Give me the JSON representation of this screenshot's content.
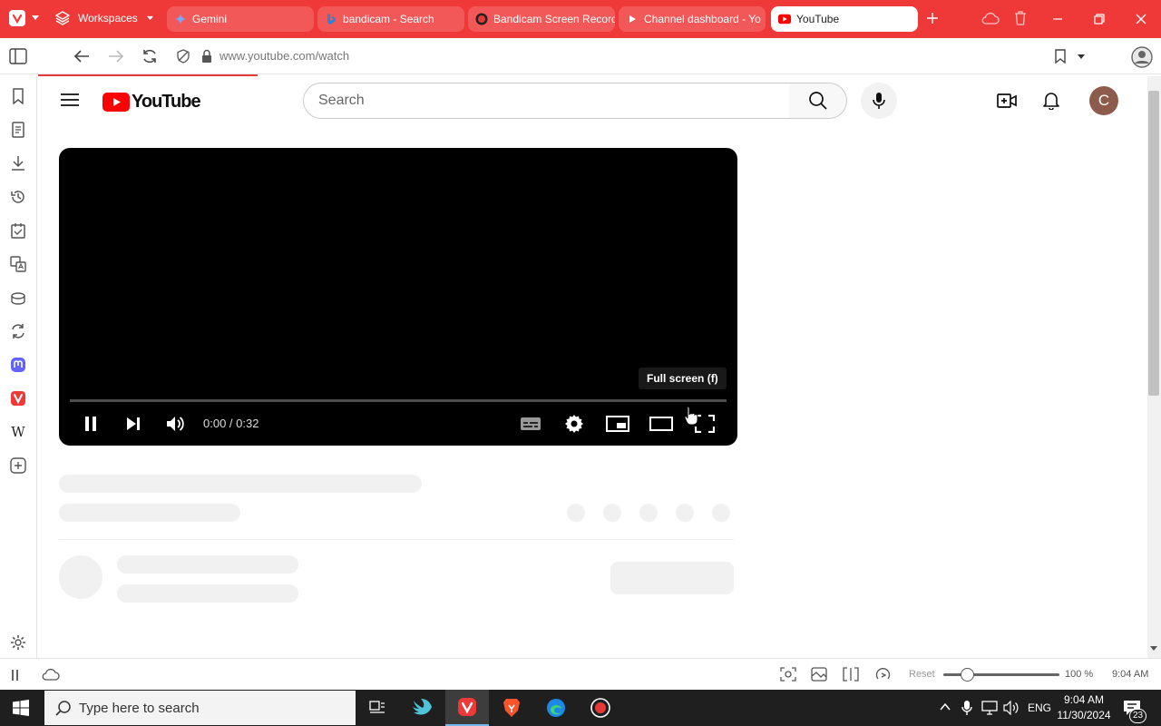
{
  "browser": {
    "workspaces_label": "Workspaces",
    "tabs": [
      {
        "label": "Gemini"
      },
      {
        "label": "bandicam - Search"
      },
      {
        "label": "Bandicam Screen Record"
      },
      {
        "label": "Channel dashboard - Yo"
      },
      {
        "label": "YouTube"
      }
    ],
    "url": "www.youtube.com/watch"
  },
  "youtube": {
    "logo_text": "YouTube",
    "search_placeholder": "Search",
    "avatar_initial": "C"
  },
  "player": {
    "tooltip": "Full screen (f)",
    "timecode": "0:00 / 0:32",
    "progress_fraction": 0
  },
  "statusbar": {
    "reset_label": "Reset",
    "zoom": "100 %",
    "clock": "9:04 AM",
    "zoom_fraction": 0.2
  },
  "taskbar": {
    "search_placeholder": "Type here to search",
    "language": "ENG",
    "time": "9:04 AM",
    "date": "11/30/2024",
    "notification_count": "23"
  },
  "colors": {
    "brand_red": "#ef3939",
    "youtube_red": "#ff0000"
  }
}
